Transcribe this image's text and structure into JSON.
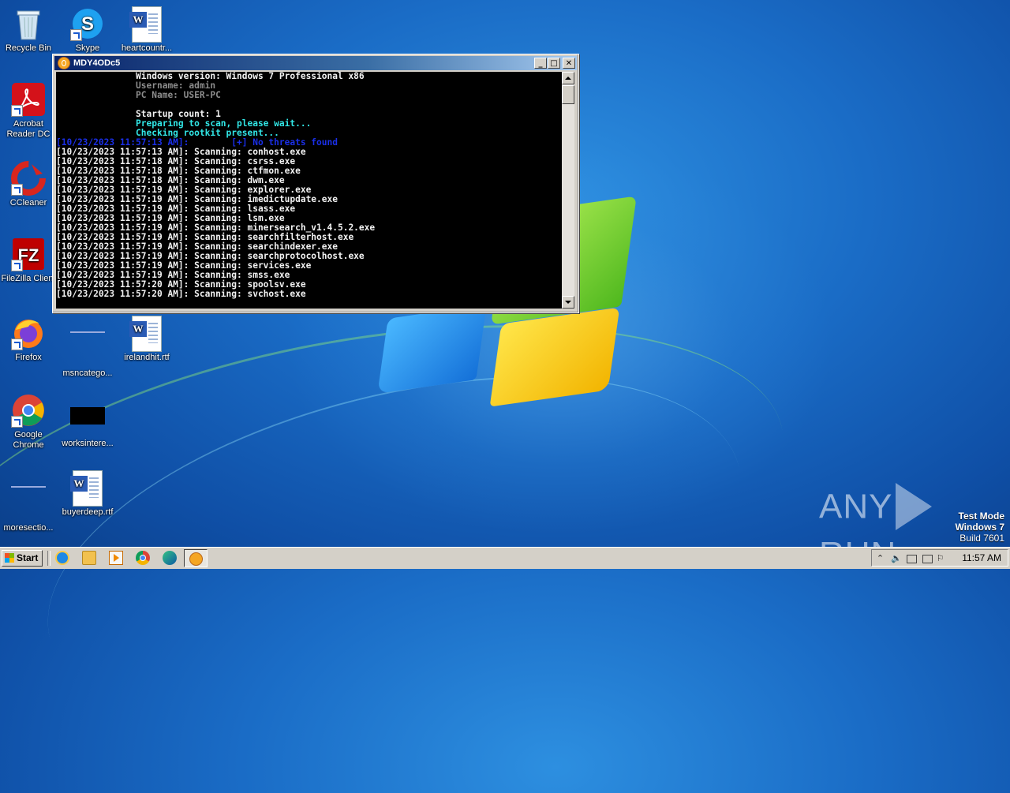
{
  "desktop": {
    "icons": [
      {
        "label": "Recycle Bin"
      },
      {
        "label": "Skype"
      },
      {
        "label": "heartcountr..."
      },
      {
        "label": "Acrobat Reader DC"
      },
      {
        "label": "CCleaner"
      },
      {
        "label": "FileZilla Client"
      },
      {
        "label": "Firefox"
      },
      {
        "label": "msncatego..."
      },
      {
        "label": "irelandhit.rtf"
      },
      {
        "label": "Google Chrome"
      },
      {
        "label": "worksintere..."
      },
      {
        "label": "moresectio..."
      },
      {
        "label": "buyerdeep.rtf"
      }
    ]
  },
  "window": {
    "title": "MDY4ODc5",
    "buttons": {
      "minimize": "_",
      "maximize": "□",
      "close": "✕"
    },
    "console_lines": [
      {
        "text": "               Windows version: Windows 7 Professional x86",
        "color": "white"
      },
      {
        "text": "               Username: admin",
        "color": "gray"
      },
      {
        "text": "               PC Name: USER-PC",
        "color": "gray"
      },
      {
        "text": "",
        "color": "white"
      },
      {
        "text": "               Startup count: 1",
        "color": "white"
      },
      {
        "text": "               Preparing to scan, please wait...",
        "color": "cyan"
      },
      {
        "text": "               Checking rootkit present...",
        "color": "cyan"
      },
      {
        "text": "[10/23/2023 11:57:13 AM]:        [+] No threats found",
        "color": "blue"
      },
      {
        "text": "[10/23/2023 11:57:13 AM]: Scanning: conhost.exe",
        "color": "white"
      },
      {
        "text": "[10/23/2023 11:57:18 AM]: Scanning: csrss.exe",
        "color": "white"
      },
      {
        "text": "[10/23/2023 11:57:18 AM]: Scanning: ctfmon.exe",
        "color": "white"
      },
      {
        "text": "[10/23/2023 11:57:18 AM]: Scanning: dwm.exe",
        "color": "white"
      },
      {
        "text": "[10/23/2023 11:57:19 AM]: Scanning: explorer.exe",
        "color": "white"
      },
      {
        "text": "[10/23/2023 11:57:19 AM]: Scanning: imedictupdate.exe",
        "color": "white"
      },
      {
        "text": "[10/23/2023 11:57:19 AM]: Scanning: lsass.exe",
        "color": "white"
      },
      {
        "text": "[10/23/2023 11:57:19 AM]: Scanning: lsm.exe",
        "color": "white"
      },
      {
        "text": "[10/23/2023 11:57:19 AM]: Scanning: minersearch_v1.4.5.2.exe",
        "color": "white"
      },
      {
        "text": "[10/23/2023 11:57:19 AM]: Scanning: searchfilterhost.exe",
        "color": "white"
      },
      {
        "text": "[10/23/2023 11:57:19 AM]: Scanning: searchindexer.exe",
        "color": "white"
      },
      {
        "text": "[10/23/2023 11:57:19 AM]: Scanning: searchprotocolhost.exe",
        "color": "white"
      },
      {
        "text": "[10/23/2023 11:57:19 AM]: Scanning: services.exe",
        "color": "white"
      },
      {
        "text": "[10/23/2023 11:57:19 AM]: Scanning: smss.exe",
        "color": "white"
      },
      {
        "text": "[10/23/2023 11:57:20 AM]: Scanning: spoolsv.exe",
        "color": "white"
      },
      {
        "text": "[10/23/2023 11:57:20 AM]: Scanning: svchost.exe",
        "color": "white"
      }
    ]
  },
  "watermark": {
    "brand_left": "ANY",
    "brand_right": "RUN",
    "test_mode": "Test Mode",
    "os": "Windows 7",
    "build": "Build 7601"
  },
  "taskbar": {
    "start_label": "Start",
    "clock": "11:57 AM"
  },
  "colors": {
    "console_bg": "#000000",
    "console_white": "#f2f2f2",
    "console_gray": "#8c8c8c",
    "console_cyan": "#31e6e6",
    "console_blue": "#1a2fe8",
    "title_active": "#0a246a"
  }
}
